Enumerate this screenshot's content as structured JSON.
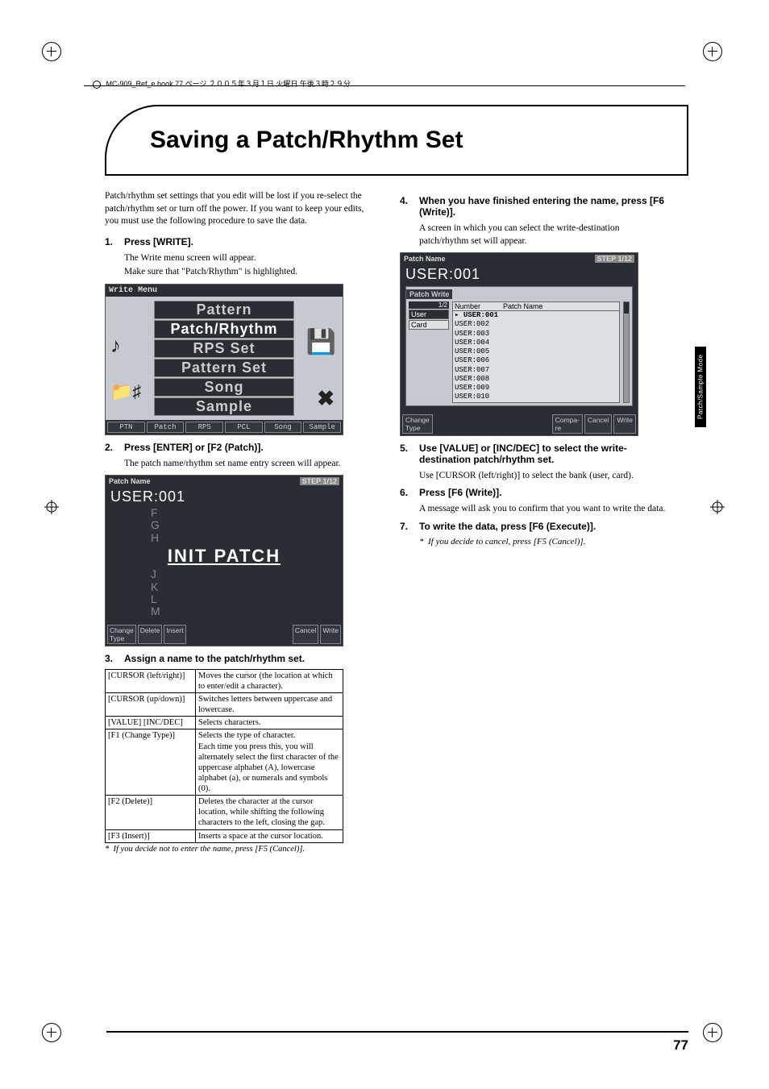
{
  "header": {
    "line": "MC-909_Ref_e.book 77 ページ ２００５年３月１日 火曜日 午後３時２９分"
  },
  "title": "Saving a Patch/Rhythm Set",
  "intro": "Patch/rhythm set settings that you edit will be lost if you re-select the patch/rhythm set or turn off the power. If you want to keep your edits, you must use the following procedure to save the data.",
  "steps_left": [
    {
      "num": "1.",
      "label": "Press [WRITE].",
      "subs": [
        "The Write menu screen will appear.",
        "Make sure that \"Patch/Rhythm\" is highlighted."
      ]
    },
    {
      "num": "2.",
      "label": "Press [ENTER] or [F2 (Patch)].",
      "subs": [
        "The patch name/rhythm set name entry screen will appear."
      ]
    },
    {
      "num": "3.",
      "label": "Assign a name to the patch/rhythm set."
    }
  ],
  "steps_right": [
    {
      "num": "4.",
      "label": "When you have finished entering the name, press [F6 (Write)].",
      "subs": [
        "A screen in which you can select the write-destination patch/rhythm set will appear."
      ]
    },
    {
      "num": "5.",
      "label": "Use [VALUE] or [INC/DEC] to select the write-destination patch/rhythm set.",
      "subs": [
        "Use [CURSOR (left/right)] to select the bank (user, card)."
      ]
    },
    {
      "num": "6.",
      "label": "Press [F6 (Write)].",
      "subs": [
        "A message will ask you to confirm that you want to write the data."
      ]
    },
    {
      "num": "7.",
      "label": "To write the data, press [F6 (Execute)]."
    }
  ],
  "note_right": "If you decide to cancel, press [F5 (Cancel)].",
  "lcd1": {
    "title": "Write Menu",
    "items": [
      "Pattern",
      "Patch/Rhythm",
      "RPS Set",
      "Pattern Set",
      "Song",
      "Sample"
    ],
    "selected": 1,
    "fkeys": [
      "PTN",
      "Patch",
      "RPS",
      "PCL",
      "Song",
      "Sample"
    ]
  },
  "lcd2": {
    "title": "Patch Name",
    "step": "STEP 1/12",
    "user": "USER:001",
    "letters_a": "F\nG\nH",
    "name": "INIT PATCH",
    "letters_b": "J\nK\nL\nM",
    "fkeys": [
      "Change\nType",
      "Delete",
      "Insert",
      "",
      "Cancel",
      "Write"
    ]
  },
  "lcd3": {
    "title": "Patch Name",
    "step": "STEP 1/12",
    "user": "USER:001",
    "panel_title": "Patch Write",
    "bank_page": "1/2",
    "banks": [
      "User",
      "Card"
    ],
    "bank_selected": 0,
    "list_hdr": [
      "Number",
      "Patch Name"
    ],
    "list": [
      "USER:001",
      "USER:002",
      "USER:003",
      "USER:004",
      "USER:005",
      "USER:006",
      "USER:007",
      "USER:008",
      "USER:009",
      "USER:010"
    ],
    "list_selected": 0,
    "fkeys_left": "Change\nType",
    "fkeys_right": [
      "Compa-\nre",
      "Cancel",
      "Write"
    ]
  },
  "table": {
    "rows": [
      [
        "[CURSOR (left/right)]",
        "Moves the cursor (the location at which to enter/edit a character)."
      ],
      [
        "[CURSOR (up/down)]",
        "Switches letters between uppercase and lowercase."
      ],
      [
        "[VALUE] [INC/DEC]",
        "Selects characters."
      ],
      [
        "[F1 (Change Type)]",
        "Selects the type of character.\nEach time you press this, you will alternately select the first character of the uppercase alphabet (A), lowercase alphabet (a), or numerals and symbols (0)."
      ],
      [
        "[F2 (Delete)]",
        "Deletes the character at the cursor location, while shifting the following characters to the left, closing the gap."
      ],
      [
        "[F3 (Insert)]",
        "Inserts a space at the cursor location."
      ]
    ],
    "note": "If you decide not to enter the name, press [F5 (Cancel)]."
  },
  "side_tab": "Patch/Sample Mode",
  "page_number": "77"
}
